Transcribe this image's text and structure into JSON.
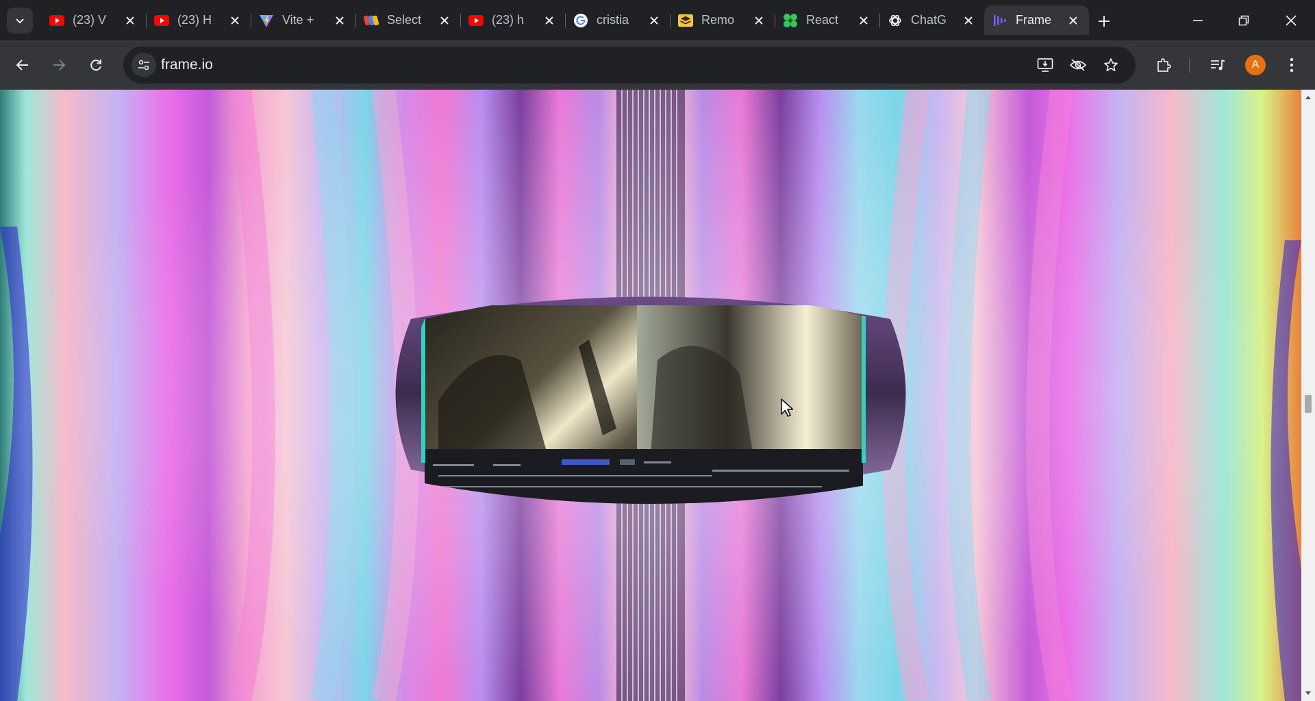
{
  "browser": {
    "tabs": [
      {
        "title": "(23) V",
        "favicon": "youtube-icon"
      },
      {
        "title": "(23) H",
        "favicon": "youtube-icon"
      },
      {
        "title": "Vite +",
        "favicon": "vite-icon"
      },
      {
        "title": "Select",
        "favicon": "multicolor-block-icon"
      },
      {
        "title": "(23) h",
        "favicon": "youtube-icon"
      },
      {
        "title": "cristia",
        "favicon": "google-icon"
      },
      {
        "title": "Remo",
        "favicon": "stack-icon"
      },
      {
        "title": "React",
        "favicon": "clover-icon"
      },
      {
        "title": "ChatG",
        "favicon": "openai-icon"
      },
      {
        "title": "Frame",
        "favicon": "frameio-icon",
        "active": true
      }
    ],
    "address": "frame.io",
    "profile_initial": "A",
    "colors": {
      "frame": "#202124",
      "toolbar": "#35363a",
      "avatar": "#e8710a",
      "youtube": "#ff0000"
    }
  },
  "page": {
    "hero_description": "",
    "scrollbar": {
      "position_fraction": 0.5
    }
  }
}
